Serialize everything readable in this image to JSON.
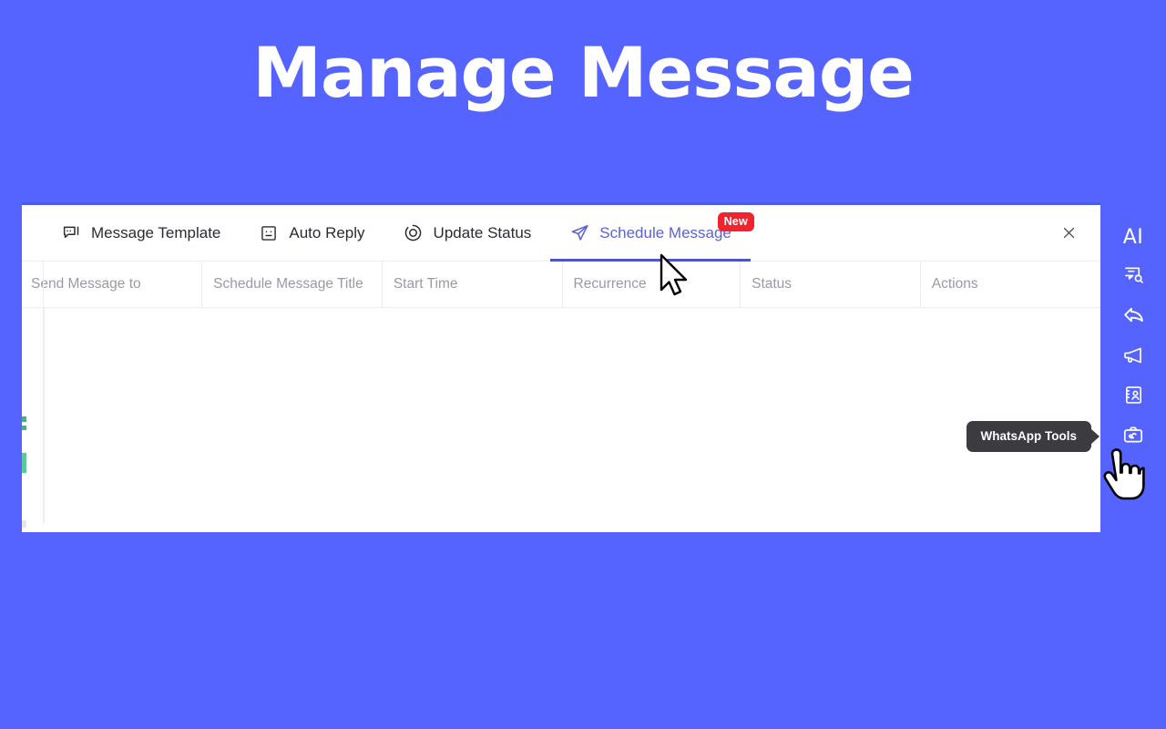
{
  "theme": {
    "background": "#5664ff",
    "panel_bg": "#ffffff",
    "accent": "#4b55c4",
    "badge_red": "#f1232f",
    "tooltip_bg": "#3b3b40",
    "header_text": "#9a9aa5"
  },
  "page": {
    "title": "Manage Message"
  },
  "tabs": [
    {
      "label": "Message Template",
      "icon": "message-template-icon",
      "active": false,
      "badge": null
    },
    {
      "label": "Auto Reply",
      "icon": "auto-reply-icon",
      "active": false,
      "badge": null
    },
    {
      "label": "Update Status",
      "icon": "update-status-icon",
      "active": false,
      "badge": null
    },
    {
      "label": "Schedule Message",
      "icon": "schedule-message-icon",
      "active": true,
      "badge": "New"
    }
  ],
  "panel": {
    "close_icon": "close-icon"
  },
  "table": {
    "columns": [
      "Send Message to",
      "Schedule Message Title",
      "Start Time",
      "Recurrence",
      "Status",
      "Actions"
    ],
    "rows": []
  },
  "sidebar": {
    "items": [
      {
        "name": "ai-button",
        "label": "AI",
        "icon": "ai-text-icon"
      },
      {
        "name": "message-search-button",
        "label": "",
        "icon": "message-search-icon"
      },
      {
        "name": "reply-button",
        "label": "",
        "icon": "reply-arrow-icon"
      },
      {
        "name": "broadcast-button",
        "label": "",
        "icon": "megaphone-icon"
      },
      {
        "name": "contacts-button",
        "label": "",
        "icon": "contact-card-icon"
      },
      {
        "name": "whatsapp-tools-button",
        "label": "",
        "icon": "toolbox-wrench-icon"
      },
      {
        "name": "add-button",
        "label": "",
        "icon": "plus-icon"
      }
    ]
  },
  "tooltip": {
    "text": "WhatsApp Tools"
  }
}
